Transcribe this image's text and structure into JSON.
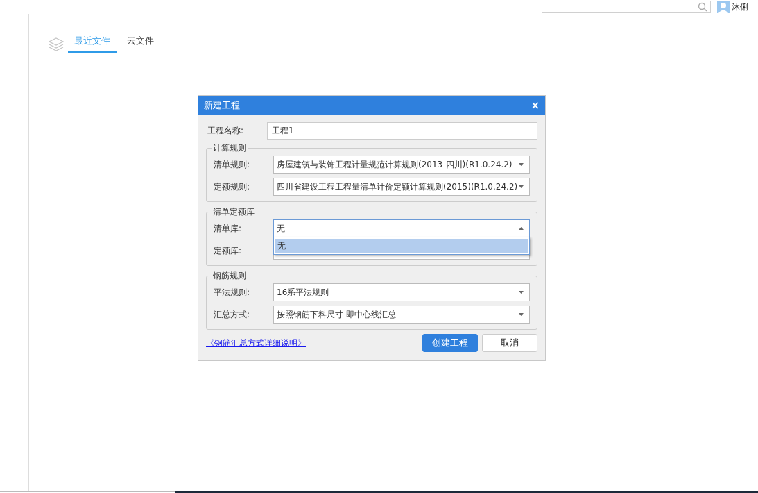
{
  "user": {
    "name": "沐俐"
  },
  "tabs": [
    {
      "label": "最近文件",
      "selected": true
    },
    {
      "label": "云文件",
      "selected": false
    }
  ],
  "dialog": {
    "title": "新建工程",
    "close": "×",
    "name_label": "工程名称:",
    "name_value": "工程1",
    "groups": [
      {
        "title": "计算规则",
        "fields": [
          {
            "label": "清单规则:",
            "value": "房屋建筑与装饰工程计量规范计算规则(2013-四川)(R1.0.24.2)",
            "expanded": false
          },
          {
            "label": "定额规则:",
            "value": "四川省建设工程工程量清单计价定额计算规则(2015)(R1.0.24.2)",
            "expanded": false
          }
        ]
      },
      {
        "title": "清单定额库",
        "fields": [
          {
            "label": "清单库:",
            "value": "无",
            "expanded": true,
            "options": [
              {
                "label": "无",
                "selected": true
              }
            ]
          },
          {
            "label": "定额库:",
            "expanded": false
          }
        ]
      },
      {
        "title": "钢筋规则",
        "fields": [
          {
            "label": "平法规则:",
            "value": "16系平法规则",
            "expanded": false
          },
          {
            "label": "汇总方式:",
            "value": "按照钢筋下料尺寸-即中心线汇总",
            "expanded": false
          }
        ]
      }
    ],
    "link": "《钢筋汇总方式详细说明》",
    "buttons": [
      {
        "label": "创建工程",
        "kind": "primary"
      },
      {
        "label": "取消",
        "kind": "default"
      }
    ]
  }
}
